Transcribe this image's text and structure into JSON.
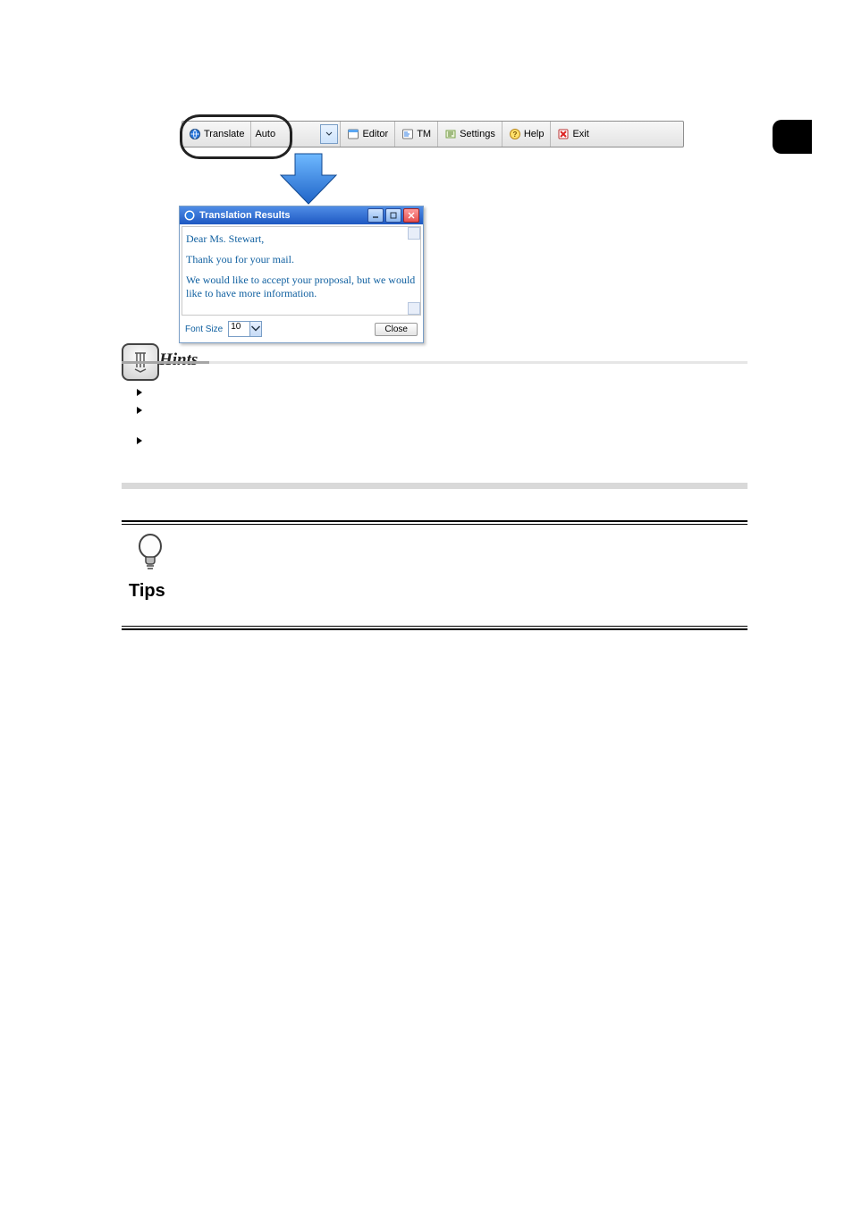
{
  "toolbar": {
    "translate_label": "Translate",
    "direction_value": "Auto",
    "editor_label": "Editor",
    "tm_label": "TM",
    "settings_label": "Settings",
    "help_label": "Help",
    "exit_label": "Exit"
  },
  "results_window": {
    "title": "Translation Results",
    "body": {
      "line1": "Dear Ms. Stewart,",
      "line2": "Thank you for your mail.",
      "line3": "We would like to accept your proposal, but we would like to have more information."
    },
    "font_size_label": "Font Size",
    "font_size_value": "10",
    "close_label": "Close"
  },
  "hints": {
    "heading": "Hints",
    "items": [
      "",
      "",
      ""
    ]
  },
  "tips": {
    "heading": "Tips",
    "body": ""
  }
}
